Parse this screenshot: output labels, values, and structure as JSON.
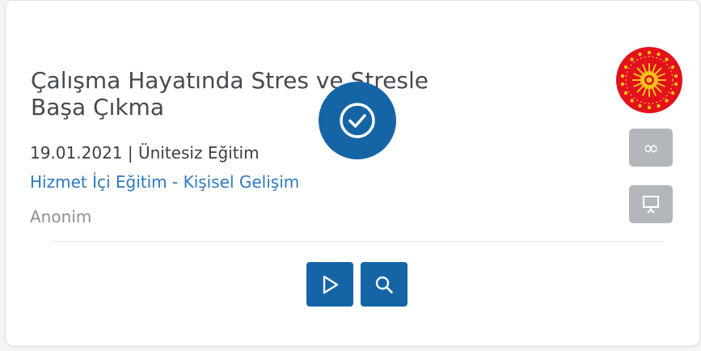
{
  "course": {
    "title": "Çalışma Hayatında Stres ve Stresle Başa Çıkma",
    "meta": "19.01.2021 | Ünitesiz Eğitim",
    "category": "Hizmet İçi Eğitim - Kişisel Gelişim",
    "author": "Anonim"
  },
  "icons": {
    "completed": "check-circle-icon",
    "play": "play-icon",
    "search": "search-icon",
    "unlimited": "infinity-icon",
    "presentation": "presentation-icon",
    "emblem": "presidential-emblem-icon"
  },
  "colors": {
    "primary": "#1565a6",
    "link": "#2e79c0",
    "muted": "#8c9196",
    "side_button": "#b3b7bb",
    "emblem_red": "#e3111c",
    "emblem_gold": "#f2c21a"
  }
}
